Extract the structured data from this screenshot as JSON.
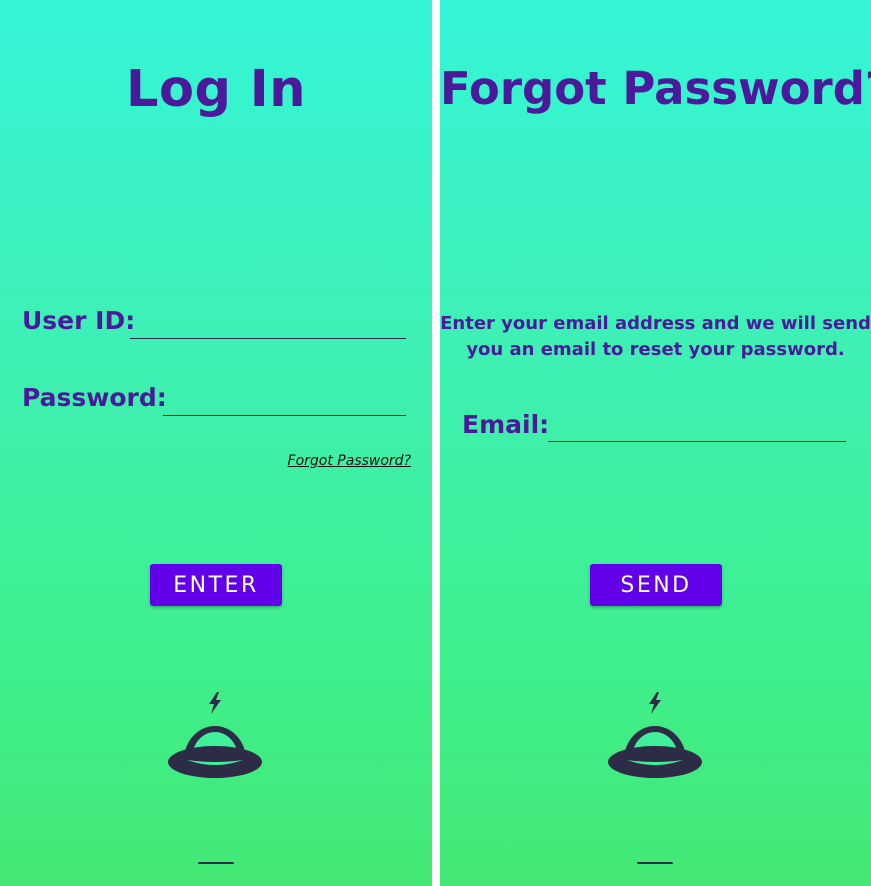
{
  "login": {
    "title": "Log In",
    "user_id_label": "User ID:",
    "user_id_value": "",
    "password_label": "Password:",
    "password_value": "",
    "forgot_link": "Forgot Password?",
    "enter_button": "ENTER",
    "logo_icon": "service-bell-icon"
  },
  "forgot": {
    "title": "Forgot Password?",
    "instructions_line1": "Enter your email address and we will send",
    "instructions_line2": "you an email to reset your password.",
    "email_label": "Email:",
    "email_value": "",
    "send_button": "SEND",
    "logo_icon": "service-bell-icon"
  },
  "colors": {
    "accent_text": "#4a1a9b",
    "button": "#6200ea",
    "gradient_top": "#35f5d8",
    "gradient_bottom": "#43e874",
    "icon": "#2c2c46"
  }
}
